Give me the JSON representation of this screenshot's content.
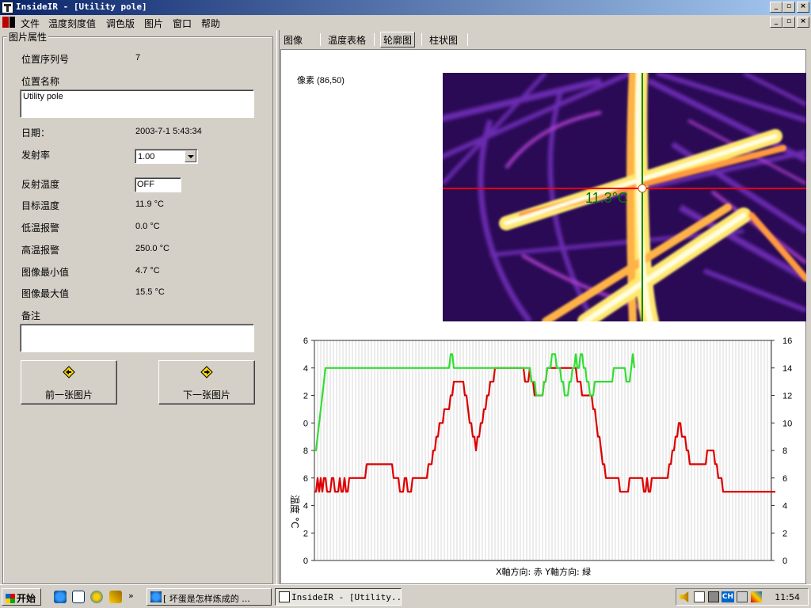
{
  "window": {
    "title": "InsideIR - [Utility pole]"
  },
  "menu": {
    "items": [
      "文件",
      "温度刻度值",
      "调色版",
      "图片",
      "窗口",
      "帮助"
    ]
  },
  "props": {
    "group_title": "图片属性",
    "seq_label": "位置序列号",
    "seq_value": "7",
    "name_label": "位置名称",
    "name_value": "Utility pole",
    "date_label": "日期：",
    "date_value": "2003-7-1 5:43:34",
    "emissivity_label": "发射率",
    "emissivity_value": "1.00",
    "reflected_label": "反射温度",
    "reflected_value": "OFF",
    "target_label": "目标温度",
    "target_value": "11.9 °C",
    "low_alarm_label": "低温报警",
    "low_alarm_value": "0.0 °C",
    "high_alarm_label": "高温报警",
    "high_alarm_value": "250.0 °C",
    "min_label": "图像最小值",
    "min_value": "4.7 °C",
    "max_label": "图像最大值",
    "max_value": "15.5 °C",
    "notes_label": "备注",
    "notes_value": "",
    "prev_button": "前一张图片",
    "next_button": "下一张图片"
  },
  "tabs": [
    "图像",
    "温度表格",
    "轮廓图",
    "柱状图"
  ],
  "active_tab": 2,
  "image": {
    "pixel_label": "像素 (86,50)",
    "spot_temp": "11.3°C"
  },
  "chart_data": {
    "type": "line",
    "left_ticks": [
      "6",
      "4",
      "2",
      "0",
      "8",
      "6",
      "4",
      "2",
      "0"
    ],
    "right_ticks": [
      "16",
      "14",
      "12",
      "10",
      "8",
      "6",
      "4",
      "2",
      "0"
    ],
    "y_range": [
      0,
      16
    ],
    "ylabel": "温度 °C",
    "xlabel": "X軸方向: 赤  Y軸方向: 緑",
    "grid": true,
    "series": [
      {
        "color": "#dd0000",
        "values": [
          5,
          5,
          6,
          5,
          6,
          5,
          6,
          6,
          5,
          5,
          5,
          6,
          6,
          5,
          5,
          5,
          6,
          5,
          5,
          6,
          5,
          5,
          6,
          6,
          6,
          6,
          6,
          6,
          6,
          6,
          6,
          6,
          6,
          7,
          7,
          7,
          7,
          7,
          7,
          7,
          7,
          7,
          7,
          7,
          7,
          7,
          7,
          7,
          7,
          7,
          6,
          6,
          6,
          6,
          5,
          5,
          5,
          6,
          6,
          5,
          5,
          5,
          6,
          6,
          6,
          6,
          6,
          6,
          6,
          6,
          6,
          6,
          7,
          7,
          7,
          8,
          8,
          9,
          9,
          10,
          10,
          10,
          11,
          11,
          11,
          11,
          12,
          12,
          13,
          13,
          13,
          13,
          13,
          13,
          13,
          12,
          12,
          11,
          10,
          10,
          9,
          9,
          8,
          9,
          9,
          10,
          10,
          11,
          11,
          12,
          12,
          13,
          13,
          13,
          14,
          14,
          14,
          14,
          14,
          14,
          14,
          14,
          14,
          14,
          14,
          14,
          14,
          14,
          14,
          14,
          14,
          14,
          14,
          13,
          13,
          13,
          14,
          13,
          13,
          12,
          12,
          12,
          12,
          12,
          12,
          13,
          13,
          14,
          14,
          14,
          14,
          14,
          14,
          14,
          14,
          14,
          14,
          14,
          14,
          14,
          14,
          14,
          14,
          14,
          14,
          14,
          13,
          13,
          13,
          12,
          12,
          12,
          12,
          12,
          12,
          12,
          11,
          11,
          10,
          9,
          9,
          8,
          7,
          7,
          6,
          6,
          6,
          6,
          6,
          6,
          6,
          6,
          6,
          5,
          5,
          5,
          5,
          5,
          5,
          6,
          6,
          6,
          6,
          6,
          6,
          6,
          6,
          6,
          5,
          5,
          6,
          5,
          5,
          6,
          6,
          6,
          6,
          6,
          6,
          6,
          6,
          6,
          6,
          6,
          7,
          7,
          8,
          8,
          9,
          9,
          10,
          10,
          9,
          9,
          9,
          8,
          8,
          7,
          7,
          7,
          7,
          7,
          7,
          7,
          7,
          7,
          7,
          7,
          8,
          8,
          8,
          8,
          8,
          7,
          7,
          6,
          6,
          6,
          5,
          5,
          5,
          5,
          5,
          5,
          5,
          5,
          5,
          5,
          5,
          5,
          5,
          5,
          5,
          5,
          5,
          5,
          5,
          5,
          5,
          5,
          5,
          5,
          5,
          5,
          5,
          5,
          5,
          5,
          5,
          5,
          5,
          5
        ]
      },
      {
        "color": "#33dd33",
        "values": [
          8,
          8,
          9,
          10,
          11,
          12,
          13,
          14,
          14,
          14,
          14,
          14,
          14,
          14,
          14,
          14,
          14,
          14,
          14,
          14,
          14,
          14,
          14,
          14,
          14,
          14,
          14,
          14,
          14,
          14,
          14,
          14,
          14,
          14,
          14,
          14,
          14,
          14,
          14,
          14,
          14,
          14,
          14,
          14,
          14,
          14,
          14,
          14,
          14,
          14,
          14,
          14,
          14,
          14,
          14,
          14,
          14,
          14,
          14,
          14,
          14,
          14,
          14,
          14,
          14,
          14,
          14,
          14,
          14,
          14,
          14,
          14,
          14,
          14,
          14,
          14,
          14,
          14,
          14,
          14,
          14,
          14,
          14,
          14,
          14,
          14,
          15,
          15,
          14,
          14,
          14,
          14,
          14,
          14,
          14,
          14,
          14,
          14,
          14,
          14,
          14,
          14,
          14,
          14,
          14,
          14,
          14,
          14,
          14,
          14,
          14,
          14,
          14,
          14,
          14,
          14,
          14,
          14,
          14,
          14,
          14,
          14,
          14,
          14,
          14,
          14,
          14,
          14,
          14,
          14,
          14,
          14,
          14,
          14,
          14,
          14,
          14,
          13,
          13,
          13,
          12,
          12,
          12,
          12,
          12,
          13,
          13,
          14,
          14,
          14,
          15,
          15,
          15,
          14,
          14,
          14,
          13,
          13,
          12,
          12,
          12,
          13,
          13,
          14,
          14,
          15,
          14,
          14,
          15,
          15,
          14,
          14,
          13,
          13,
          12,
          12,
          12,
          13,
          13,
          13,
          13,
          13,
          13,
          13,
          13,
          13,
          13,
          13,
          13,
          14,
          14,
          14,
          14,
          14,
          14,
          14,
          14,
          13,
          13,
          13,
          14,
          15,
          14
        ]
      }
    ]
  },
  "taskbar": {
    "start": "开始",
    "tasks": [
      "[ 坏蛋是怎样炼成的 ...",
      "InsideIR - [Utility..."
    ],
    "tray_lang": "CH",
    "clock": "11:54"
  }
}
